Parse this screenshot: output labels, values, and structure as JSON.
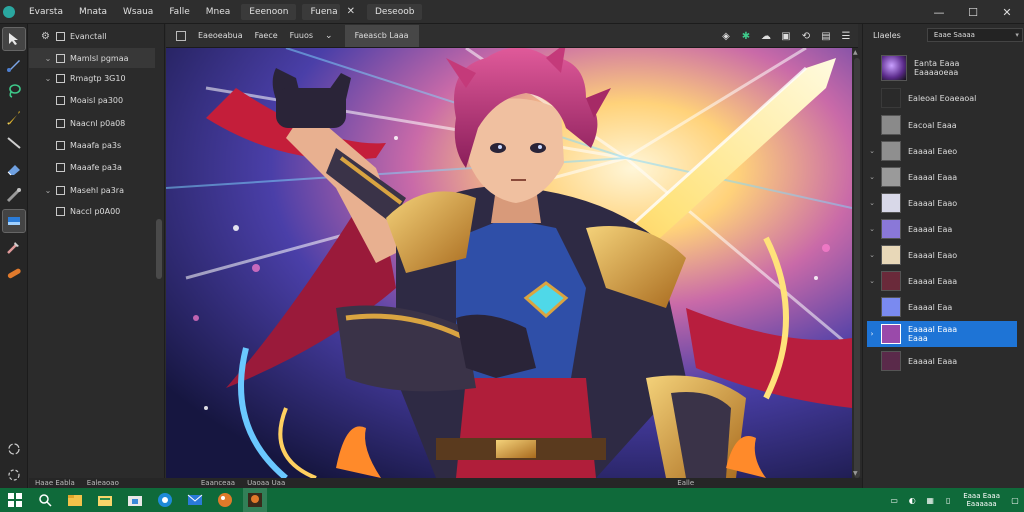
{
  "menubar": {
    "items": [
      "Evarsta",
      "Mnata",
      "Wsaua",
      "Falle",
      "Mnea"
    ],
    "boxed_items": [
      "Eeenoon",
      "Fuena"
    ],
    "doc_tab_label": "Deseoob"
  },
  "left_panel": {
    "root_label": "Evanctall",
    "rows": [
      "Mamlsl pgmaa",
      "Rmagtp 3G10",
      "Moaisl pa300",
      "Naacnl p0a08",
      "Maaafa pa3s",
      "Maaafe pa3a",
      "Masehl pa3ra",
      "Naccl p0A00"
    ]
  },
  "doc_tabs": {
    "tabs": [
      "Eaeoeabua",
      "Faece",
      "Fuuos"
    ],
    "active_tab": "Faeascb Laaa"
  },
  "status_bar": {
    "items": [
      "Haae Eabla",
      "Ealeaoao",
      "Eaanceaa",
      "Uaoaa Uaa",
      "Ealle"
    ]
  },
  "right_panel": {
    "title": "Llaeles",
    "select_value": "Eaae Saaaa",
    "layers": [
      {
        "name": "Eanta Eaaa",
        "sub": "Eaaaaoeaa"
      },
      {
        "name": "Ealeoal Eoaeaoal",
        "sub": ""
      },
      {
        "name": "Eacoal Eaaa",
        "sub": ""
      },
      {
        "name": "Eaaaal Eaeo",
        "sub": ""
      },
      {
        "name": "Eaaaal Eaaa",
        "sub": ""
      },
      {
        "name": "Eaaaal Eaao",
        "sub": ""
      },
      {
        "name": "Eaaaal Eaa",
        "sub": ""
      },
      {
        "name": "Eaaaal Eaao",
        "sub": ""
      },
      {
        "name": "Eaaaal Eaaa",
        "sub": ""
      },
      {
        "name": "Eaaaal Eaa",
        "sub": ""
      },
      {
        "name": "Eaaaal Eaaa",
        "sub": "Eaaa"
      },
      {
        "name": "Eaaaal Eaaa",
        "sub": ""
      }
    ]
  },
  "taskbar": {
    "clock_time": "Eaaa Eaaa",
    "clock_date": "Eaaaaaa"
  },
  "colors": {
    "accent": "#1e74d6",
    "taskbar": "#0f6a3a",
    "panel": "#2b2b2b"
  },
  "icons": {
    "tools": [
      "select-arrow-icon",
      "brush-icon",
      "lasso-icon",
      "pen-icon",
      "line-icon",
      "eraser-icon",
      "smudge-icon",
      "fill-icon",
      "transform-icon",
      "bandage-icon"
    ],
    "tools_bottom": [
      "rotate-icon",
      "reset-icon"
    ],
    "taskbar": [
      "windows-start-icon",
      "search-icon",
      "file-explorer-icon",
      "folder-icon",
      "store-icon",
      "browser-icon",
      "mail-icon",
      "paint-app-icon",
      "active-app-icon"
    ]
  }
}
